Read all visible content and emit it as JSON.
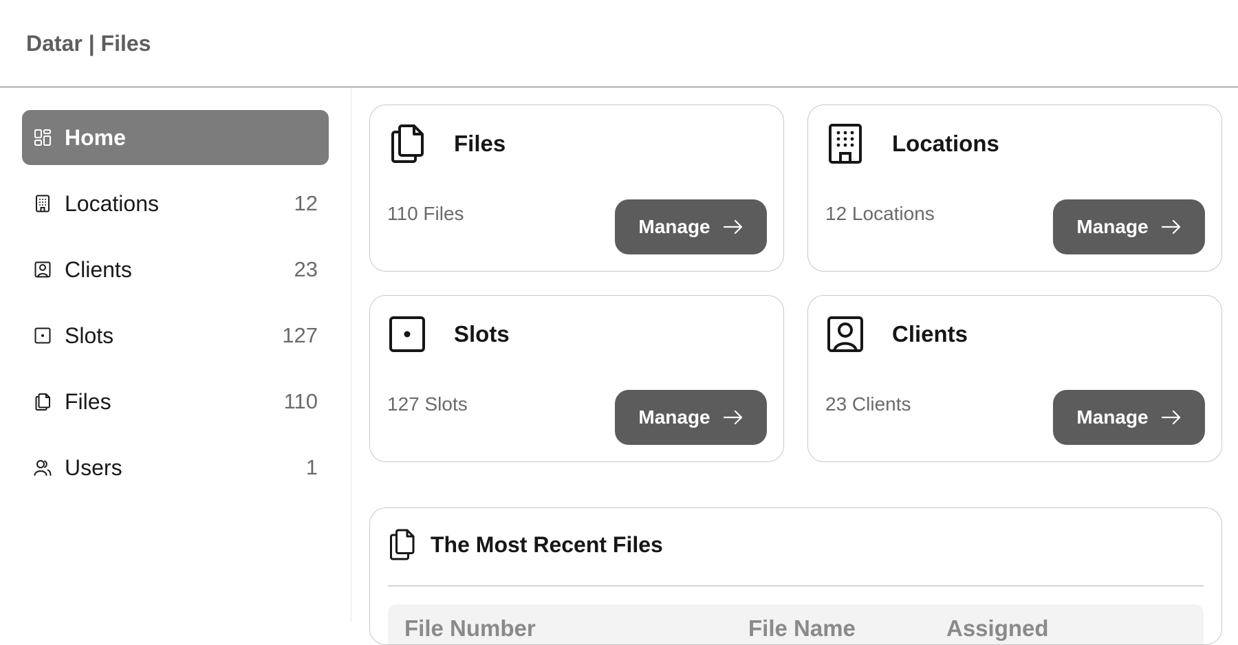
{
  "header": {
    "title": "Datar | Files"
  },
  "sidebar": {
    "items": [
      {
        "label": "Home",
        "count": "",
        "icon": "dashboard-icon",
        "active": true
      },
      {
        "label": "Locations",
        "count": "12",
        "icon": "building-icon"
      },
      {
        "label": "Clients",
        "count": "23",
        "icon": "person-badge-icon"
      },
      {
        "label": "Slots",
        "count": "127",
        "icon": "square-dot-icon"
      },
      {
        "label": "Files",
        "count": "110",
        "icon": "files-icon"
      },
      {
        "label": "Users",
        "count": "1",
        "icon": "users-icon"
      }
    ]
  },
  "cards": [
    {
      "title": "Files",
      "count_text": "110 Files",
      "button": "Manage",
      "icon": "files-icon"
    },
    {
      "title": "Locations",
      "count_text": "12 Locations",
      "button": "Manage",
      "icon": "building-icon"
    },
    {
      "title": "Slots",
      "count_text": "127 Slots",
      "button": "Manage",
      "icon": "square-dot-icon"
    },
    {
      "title": "Clients",
      "count_text": "23 Clients",
      "button": "Manage",
      "icon": "person-badge-icon"
    }
  ],
  "recent": {
    "title": "The Most Recent Files",
    "icon": "files-icon",
    "columns": [
      "File Number",
      "File Name",
      "Assigned"
    ]
  },
  "colors": {
    "active_nav": "#7c7c7c",
    "button": "#5c5c5c",
    "header_text": "#5e5e5e"
  }
}
